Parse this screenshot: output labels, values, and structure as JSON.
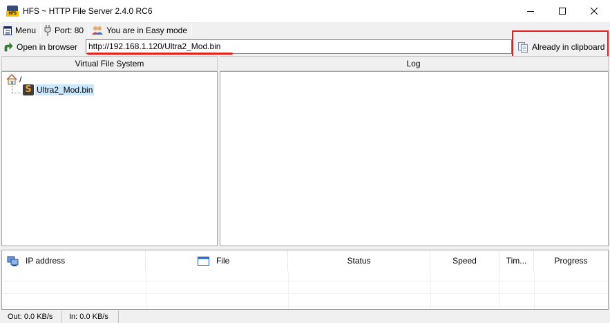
{
  "window": {
    "title": "HFS ~ HTTP File Server 2.4.0 RC6",
    "app_icon_text": "HFS"
  },
  "toolbar": {
    "menu_label": "Menu",
    "port_label": "Port: 80",
    "mode_label": "You are in Easy mode",
    "open_browser_label": "Open in browser",
    "url_value": "http://192.168.1.120/Ultra2_Mod.bin",
    "clipboard_label": "Already in clipboard"
  },
  "panels": {
    "vfs_title": "Virtual File System",
    "log_title": "Log"
  },
  "vfs": {
    "root_label": "/",
    "items": [
      {
        "label": "Ultra2_Mod.bin",
        "icon": "S"
      }
    ]
  },
  "connections": {
    "columns": [
      "IP address",
      "File",
      "Status",
      "Speed",
      "Tim...",
      "Progress"
    ]
  },
  "statusbar": {
    "out": "Out: 0.0 KB/s",
    "in": "In: 0.0 KB/s"
  },
  "colors": {
    "highlight_red": "#e0201c",
    "selection_blue": "#cce8ff"
  }
}
